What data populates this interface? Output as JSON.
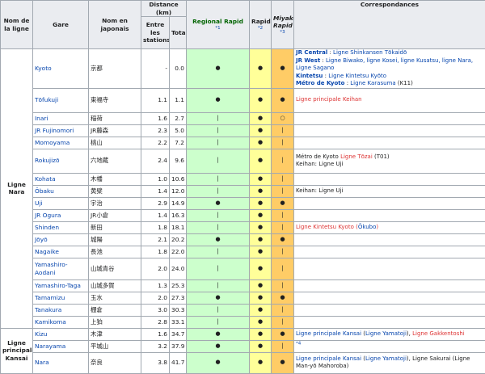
{
  "headers": {
    "line": "Nom de la ligne",
    "station": "Gare",
    "japanese": "Nom en japonais",
    "distance": "Distance (km)",
    "between": "Entre les stations",
    "total": "Total",
    "regional": "Regional Rapid",
    "regional_note": "*1",
    "rapid": "Rapid",
    "rapid_note": "*2",
    "miyakoji": "Miyakoji Rapid",
    "miyakoji_note": "*3",
    "corr": "Correspondances"
  },
  "lines": {
    "nara": "Ligne Nara",
    "kansai": "Ligne principale Kansai"
  },
  "rows": [
    {
      "name": "Kyoto",
      "jp": "京都",
      "d": "-",
      "t": "0.0",
      "r": "●",
      "ra": "●",
      "m": "●"
    },
    {
      "name": "Tōfukuji",
      "jp": "東福寺",
      "d": "1.1",
      "t": "1.1",
      "r": "●",
      "ra": "●",
      "m": "●"
    },
    {
      "name": "Inari",
      "jp": "稲荷",
      "d": "1.6",
      "t": "2.7",
      "r": "|",
      "ra": "●",
      "m": "○"
    },
    {
      "name": "JR Fujinomori",
      "jp": "JR藤森",
      "d": "2.3",
      "t": "5.0",
      "r": "|",
      "ra": "●",
      "m": "|"
    },
    {
      "name": "Momoyama",
      "jp": "桃山",
      "d": "2.2",
      "t": "7.2",
      "r": "|",
      "ra": "●",
      "m": "|"
    },
    {
      "name": "Rokujizō",
      "jp": "六地蔵",
      "d": "2.4",
      "t": "9.6",
      "r": "|",
      "ra": "●",
      "m": "|"
    },
    {
      "name": "Kohata",
      "jp": "木幡",
      "d": "1.0",
      "t": "10.6",
      "r": "|",
      "ra": "●",
      "m": "|"
    },
    {
      "name": "Ōbaku",
      "jp": "黄檗",
      "d": "1.4",
      "t": "12.0",
      "r": "|",
      "ra": "●",
      "m": "|"
    },
    {
      "name": "Uji",
      "jp": "宇治",
      "d": "2.9",
      "t": "14.9",
      "r": "●",
      "ra": "●",
      "m": "●"
    },
    {
      "name": "JR Ogura",
      "jp": "JR小倉",
      "d": "1.4",
      "t": "16.3",
      "r": "|",
      "ra": "●",
      "m": "|"
    },
    {
      "name": "Shinden",
      "jp": "新田",
      "d": "1.8",
      "t": "18.1",
      "r": "|",
      "ra": "●",
      "m": "|"
    },
    {
      "name": "Jōyō",
      "jp": "城陽",
      "d": "2.1",
      "t": "20.2",
      "r": "●",
      "ra": "●",
      "m": "●"
    },
    {
      "name": "Nagaike",
      "jp": "長池",
      "d": "1.8",
      "t": "22.0",
      "r": "|",
      "ra": "●",
      "m": "|"
    },
    {
      "name": "Yamashiro-Aodani",
      "jp": "山城青谷",
      "d": "2.0",
      "t": "24.0",
      "r": "|",
      "ra": "●",
      "m": "|"
    },
    {
      "name": "Yamashiro-Taga",
      "jp": "山城多賀",
      "d": "1.3",
      "t": "25.3",
      "r": "|",
      "ra": "●",
      "m": "|"
    },
    {
      "name": "Tamamizu",
      "jp": "玉水",
      "d": "2.0",
      "t": "27.3",
      "r": "●",
      "ra": "●",
      "m": "●"
    },
    {
      "name": "Tanakura",
      "jp": "棚倉",
      "d": "3.0",
      "t": "30.3",
      "r": "|",
      "ra": "●",
      "m": "|"
    },
    {
      "name": "Kamikoma",
      "jp": "上狛",
      "d": "2.8",
      "t": "33.1",
      "r": "|",
      "ra": "●",
      "m": "|"
    },
    {
      "name": "Kizu",
      "jp": "木津",
      "d": "1.6",
      "t": "34.7",
      "r": "●",
      "ra": "●",
      "m": "●"
    },
    {
      "name": "Narayama",
      "jp": "平城山",
      "d": "3.2",
      "t": "37.9",
      "r": "●",
      "ra": "●",
      "m": "|"
    },
    {
      "name": "Nara",
      "jp": "奈良",
      "d": "3.8",
      "t": "41.7",
      "r": "●",
      "ra": "●",
      "m": "●"
    }
  ],
  "corr": {
    "kyoto": {
      "l1_op": "JR Central",
      "l1_sep": " : ",
      "l1_lines": "Ligne Shinkansen Tōkaidō",
      "l2_op": "JR West",
      "l2_sep": " : ",
      "l2_lines": "Ligne Biwako, ligne Kosei, ligne Kusatsu, ligne Nara, Ligne Sagano",
      "l3_op": "Kintetsu",
      "l3_sep": " : ",
      "l3_lines": "Ligne Kintetsu Kyōto",
      "l4_op": "Métro de Kyoto",
      "l4_sep": " : ",
      "l4_lines": "Ligne Karasuma",
      "l4_code": " (K11)"
    },
    "tofukuji": "Ligne principale Keihan",
    "rokujizo": {
      "l1_pre": "Métro de Kyoto ",
      "l1_line": "Ligne Tōzai",
      "l1_code": " (T01)",
      "l2": "Keihan: Ligne Uji"
    },
    "obaku": "Keihan: Ligne Uji",
    "shinden": {
      "line": "Ligne Kintetsu Kyoto",
      "open": " (",
      "station": "Ōkubo",
      "close": ")"
    },
    "kizu": {
      "a": "Ligne principale Kansai",
      "b": " (",
      "c": "Ligne Yamatoji",
      "d": "), ",
      "e": "Ligne Gakkentoshi"
    },
    "narayama": "*4",
    "nara": {
      "a": "Ligne principale Kansai",
      "b": " (",
      "c": "Ligne Yamatoji",
      "d": "), Ligne Sakurai (Ligne Man-yō Mahoroba)"
    }
  }
}
